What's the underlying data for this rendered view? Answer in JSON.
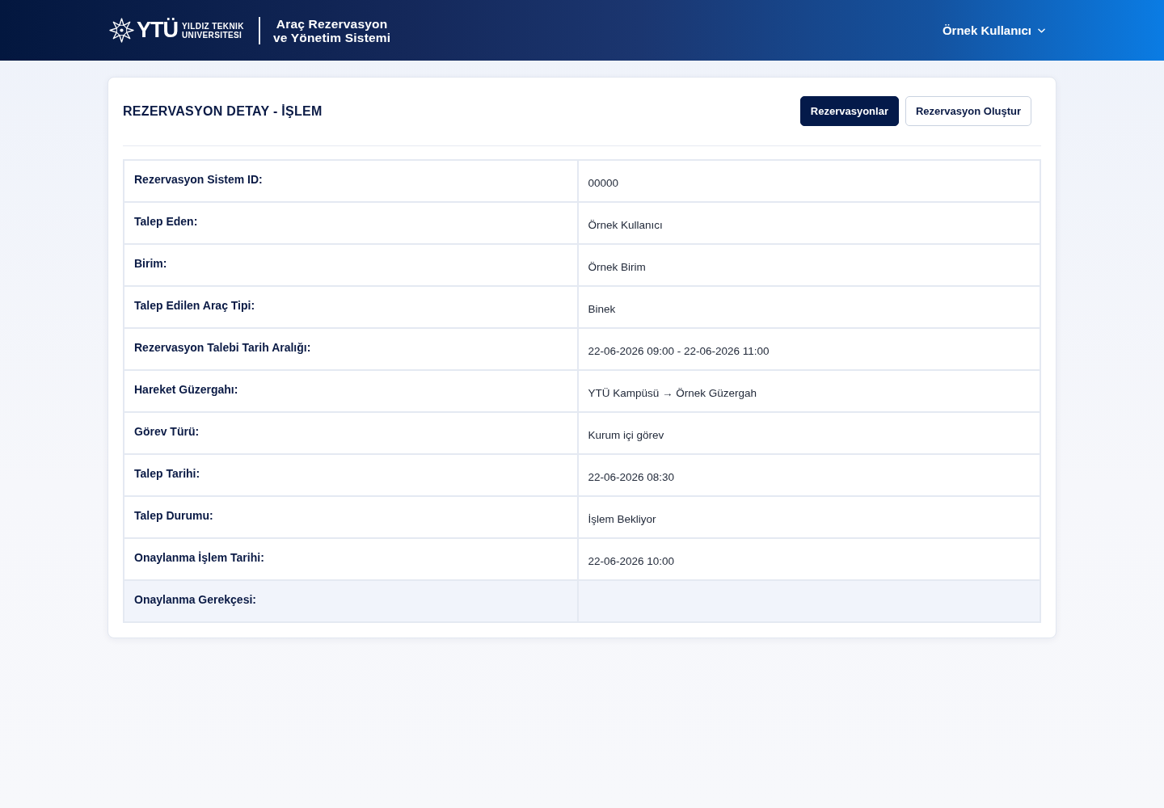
{
  "header": {
    "logo": {
      "mark": "YTÜ",
      "name_lines": [
        "YILDIZ TEKNIK",
        "UNIVERSITESI"
      ]
    },
    "app_title": [
      "Araç Rezervasyon",
      "ve Yönetim Sistemi"
    ],
    "user_menu": {
      "label": "Örnek Kullanıcı"
    }
  },
  "card": {
    "title": "REZERVASYON DETAY - İŞLEM",
    "buttons": [
      {
        "label": "Rezervasyonlar",
        "kind": "primary"
      },
      {
        "label": "Rezervasyon Oluştur",
        "kind": "outline"
      }
    ],
    "rows": [
      {
        "label": "Rezervasyon Sistem ID:",
        "value": "00000",
        "highlighted": false
      },
      {
        "label": "Talep Eden:",
        "value": "Örnek Kullanıcı",
        "highlighted": false
      },
      {
        "label": "Birim:",
        "value": "Örnek Birim",
        "highlighted": false
      },
      {
        "label": "Talep Edilen Araç Tipi:",
        "value": "Binek",
        "highlighted": false
      },
      {
        "label": "Rezervasyon Talebi Tarih Aralığı:",
        "value": "22-06-2026 09:00 - 22-06-2026 11:00",
        "highlighted": false
      },
      {
        "label": "Hareket Güzergahı:",
        "value": "YTÜ Kampüsü → Örnek Güzergah",
        "highlighted": false
      },
      {
        "label": "Görev Türü:",
        "value": "Kurum içi görev",
        "highlighted": false
      },
      {
        "label": "Talep Tarihi:",
        "value": "22-06-2026 08:30",
        "highlighted": false
      },
      {
        "label": "Talep Durumu:",
        "value": "İşlem Bekliyor",
        "highlighted": false
      },
      {
        "label": "Onaylanma İşlem Tarihi:",
        "value": "22-06-2026 10:00",
        "highlighted": false
      },
      {
        "label": "Onaylanma Gerekçesi:",
        "highlighted": true
      }
    ]
  }
}
